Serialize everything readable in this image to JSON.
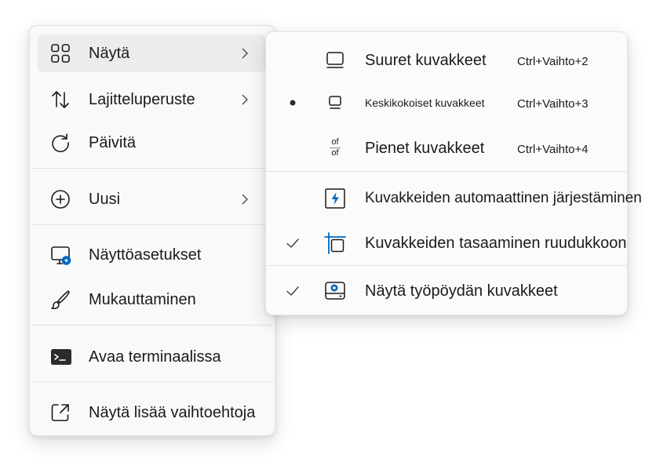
{
  "context_menu": {
    "items": [
      {
        "label": "Näytä",
        "icon": "grid-icon",
        "has_submenu": true,
        "hovered": true
      },
      {
        "label": "Lajitteluperuste",
        "icon": "sort-arrows-icon",
        "has_submenu": true
      },
      {
        "label": "Päivitä",
        "icon": "refresh-icon",
        "has_submenu": false
      },
      {
        "label": "Uusi",
        "icon": "add-circle-icon",
        "has_submenu": true
      },
      {
        "label": "Näyttöasetukset",
        "icon": "display-settings-icon",
        "has_submenu": false
      },
      {
        "label": "Mukauttaminen",
        "icon": "brush-icon",
        "has_submenu": false
      },
      {
        "label": "Avaa terminaalissa",
        "icon": "terminal-icon",
        "has_submenu": false
      },
      {
        "label": "Näytä lisää vaihtoehtoja",
        "icon": "open-external-icon",
        "has_submenu": false
      }
    ]
  },
  "submenu": {
    "items": [
      {
        "label": "Suuret kuvakkeet",
        "shortcut": "Ctrl+Vaihto+2",
        "icon": "large-icons-icon",
        "state": "none"
      },
      {
        "label": "Keskikokoiset kuvakkeet",
        "shortcut": "Ctrl+Vaihto+3",
        "icon": "medium-icons-icon",
        "state": "selected"
      },
      {
        "label": "Pienet kuvakkeet",
        "shortcut": "Ctrl+Vaihto+4",
        "icon": "small-icons-icon",
        "state": "none",
        "icon_text_top": "of",
        "icon_text_bottom": "of"
      },
      {
        "label": "Kuvakkeiden automaattinen järjestäminen",
        "icon": "auto-arrange-icon",
        "state": "none"
      },
      {
        "label": "Kuvakkeiden tasaaminen ruudukkoon",
        "icon": "align-grid-icon",
        "state": "checked"
      },
      {
        "label": "Näytä työpöydän kuvakkeet",
        "icon": "show-desktop-icons-icon",
        "state": "checked"
      }
    ]
  },
  "colors": {
    "accent": "#0067c0",
    "icon_stroke": "#1b1b1b",
    "hover_bg": "#ececec"
  }
}
